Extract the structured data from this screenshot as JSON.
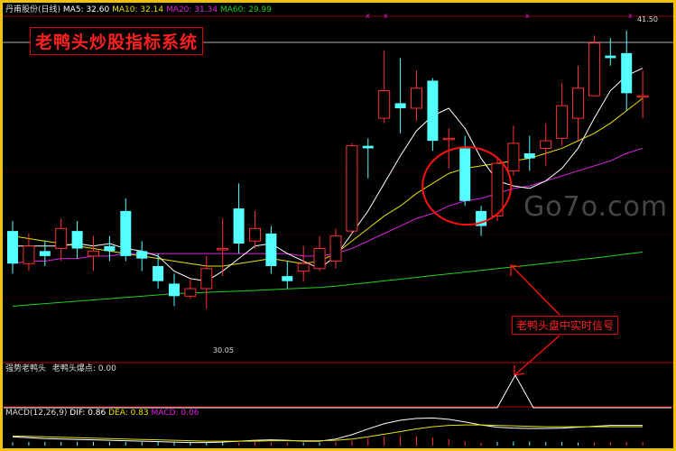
{
  "header": {
    "stock": "丹甫股份(日线)",
    "ma5": "MA5: 32.60",
    "ma10": "MA10: 32.14",
    "ma20": "MA20: 31.34",
    "ma60": "MA60: 29.99"
  },
  "title": "老鸭头炒股指标系统",
  "price_high": "41.50",
  "price_low": "30.05",
  "signal_label": "老鸭头盘中实时信号",
  "watermark": "Go7o.com",
  "indicator_header": {
    "name": "强势老鸭头",
    "buy": "老鸭头爆点: 0.00"
  },
  "macd_header": {
    "name": "MACD(12,26,9)",
    "dif": "DIF: 0.86",
    "dea": "DEA: 0.83",
    "macd": "MACD: 0.06"
  },
  "colors": {
    "up": "#ff3030",
    "down": "#54ffff",
    "ma5": "#ffffff",
    "ma10": "#e8e000",
    "ma20": "#e020e0",
    "ma60": "#20d020",
    "frame": "#f2c200"
  },
  "chart_data": {
    "type": "candlestick",
    "ylim": [
      28.5,
      42.0
    ],
    "candles": [
      {
        "o": 33.5,
        "c": 32.2,
        "h": 33.9,
        "l": 31.8
      },
      {
        "o": 32.2,
        "c": 32.9,
        "h": 33.4,
        "l": 31.9
      },
      {
        "o": 32.7,
        "c": 32.5,
        "h": 33.1,
        "l": 32.1
      },
      {
        "o": 32.8,
        "c": 33.6,
        "h": 34.0,
        "l": 32.3
      },
      {
        "o": 33.5,
        "c": 32.8,
        "h": 33.9,
        "l": 32.4
      },
      {
        "o": 32.5,
        "c": 32.7,
        "h": 33.3,
        "l": 31.9
      },
      {
        "o": 32.9,
        "c": 32.7,
        "h": 33.3,
        "l": 32.3
      },
      {
        "o": 34.3,
        "c": 32.5,
        "h": 34.8,
        "l": 32.3
      },
      {
        "o": 32.7,
        "c": 32.4,
        "h": 33.1,
        "l": 31.9
      },
      {
        "o": 32.1,
        "c": 31.5,
        "h": 32.6,
        "l": 31.2
      },
      {
        "o": 31.4,
        "c": 30.9,
        "h": 31.8,
        "l": 30.5
      },
      {
        "o": 30.9,
        "c": 31.2,
        "h": 31.6,
        "l": 30.8
      },
      {
        "o": 31.2,
        "c": 32.0,
        "h": 32.5,
        "l": 30.4
      },
      {
        "o": 32.8,
        "c": 32.8,
        "h": 34.0,
        "l": 31.7
      },
      {
        "o": 34.4,
        "c": 33.0,
        "h": 35.4,
        "l": 32.6
      },
      {
        "o": 33.1,
        "c": 33.6,
        "h": 34.3,
        "l": 32.8
      },
      {
        "o": 33.4,
        "c": 32.1,
        "h": 33.7,
        "l": 31.8
      },
      {
        "o": 31.7,
        "c": 31.5,
        "h": 32.3,
        "l": 31.2
      },
      {
        "o": 31.9,
        "c": 32.2,
        "h": 32.9,
        "l": 31.5
      },
      {
        "o": 32.0,
        "c": 32.8,
        "h": 33.3,
        "l": 31.9
      },
      {
        "o": 32.3,
        "c": 33.3,
        "h": 33.6,
        "l": 32.0
      },
      {
        "o": 33.5,
        "c": 36.9,
        "h": 37.0,
        "l": 33.4
      },
      {
        "o": 36.9,
        "c": 36.8,
        "h": 37.2,
        "l": 35.6
      },
      {
        "o": 38.0,
        "c": 39.1,
        "h": 40.7,
        "l": 37.8
      },
      {
        "o": 38.6,
        "c": 38.4,
        "h": 40.4,
        "l": 37.4
      },
      {
        "o": 38.4,
        "c": 39.2,
        "h": 39.9,
        "l": 37.9
      },
      {
        "o": 39.5,
        "c": 37.1,
        "h": 39.6,
        "l": 36.7
      },
      {
        "o": 37.2,
        "c": 37.2,
        "h": 37.6,
        "l": 36.0
      },
      {
        "o": 36.8,
        "c": 34.7,
        "h": 37.3,
        "l": 34.5
      },
      {
        "o": 34.3,
        "c": 33.7,
        "h": 34.5,
        "l": 33.3
      },
      {
        "o": 34.1,
        "c": 36.2,
        "h": 36.4,
        "l": 33.9
      },
      {
        "o": 35.9,
        "c": 37.0,
        "h": 37.7,
        "l": 35.7
      },
      {
        "o": 36.6,
        "c": 36.4,
        "h": 37.3,
        "l": 35.9
      },
      {
        "o": 36.8,
        "c": 37.1,
        "h": 37.8,
        "l": 36.1
      },
      {
        "o": 37.2,
        "c": 38.5,
        "h": 39.4,
        "l": 36.9
      },
      {
        "o": 38.0,
        "c": 39.2,
        "h": 40.1,
        "l": 37.1
      },
      {
        "o": 38.9,
        "c": 41.0,
        "h": 41.3,
        "l": 38.9
      },
      {
        "o": 40.5,
        "c": 40.4,
        "h": 41.2,
        "l": 40.1
      },
      {
        "o": 40.6,
        "c": 39.0,
        "h": 41.5,
        "l": 38.3
      },
      {
        "o": 38.9,
        "c": 38.9,
        "h": 39.9,
        "l": 38.0
      }
    ],
    "ma5": [
      32.9,
      32.9,
      32.9,
      32.9,
      33.0,
      32.9,
      33.0,
      32.8,
      32.7,
      32.5,
      31.9,
      31.6,
      31.5,
      31.9,
      32.4,
      32.9,
      33.0,
      32.6,
      32.3,
      32.0,
      32.5,
      33.4,
      34.3,
      35.4,
      36.5,
      37.5,
      38.1,
      38.4,
      37.6,
      36.4,
      35.5,
      35.3,
      35.2,
      35.5,
      36.0,
      36.8,
      38.0,
      39.1,
      39.7,
      40.0
    ],
    "ma10": [
      33.3,
      33.2,
      33.1,
      33.0,
      32.9,
      32.8,
      32.7,
      32.6,
      32.5,
      32.4,
      32.3,
      32.2,
      32.1,
      32.1,
      32.2,
      32.3,
      32.4,
      32.3,
      32.2,
      32.3,
      32.6,
      33.1,
      33.6,
      34.1,
      34.5,
      35.0,
      35.4,
      35.8,
      36.0,
      36.1,
      36.2,
      36.3,
      36.4,
      36.6,
      36.8,
      37.1,
      37.4,
      37.8,
      38.3,
      38.8
    ],
    "ma20": [
      32.2,
      32.3,
      32.3,
      32.4,
      32.4,
      32.5,
      32.5,
      32.6,
      32.6,
      32.6,
      32.6,
      32.6,
      32.6,
      32.6,
      32.6,
      32.6,
      32.6,
      32.6,
      32.5,
      32.5,
      32.6,
      32.8,
      33.1,
      33.4,
      33.7,
      34.0,
      34.2,
      34.5,
      34.7,
      34.8,
      35.0,
      35.2,
      35.3,
      35.5,
      35.7,
      35.9,
      36.1,
      36.3,
      36.6,
      36.8
    ],
    "ma60": [
      30.5,
      30.55,
      30.6,
      30.65,
      30.7,
      30.75,
      30.8,
      30.85,
      30.9,
      30.95,
      31.0,
      31.02,
      31.05,
      31.08,
      31.1,
      31.13,
      31.16,
      31.19,
      31.22,
      31.25,
      31.3,
      31.37,
      31.44,
      31.51,
      31.58,
      31.65,
      31.72,
      31.79,
      31.86,
      31.93,
      32.0,
      32.07,
      32.14,
      32.21,
      32.28,
      32.35,
      32.42,
      32.5,
      32.58,
      32.66
    ],
    "signal_index": 31,
    "macd": {
      "dif": [
        0.6,
        0.58,
        0.56,
        0.55,
        0.54,
        0.53,
        0.52,
        0.51,
        0.5,
        0.49,
        0.48,
        0.47,
        0.47,
        0.48,
        0.5,
        0.52,
        0.53,
        0.52,
        0.5,
        0.5,
        0.55,
        0.65,
        0.78,
        0.9,
        0.98,
        1.02,
        1.03,
        1.0,
        0.94,
        0.87,
        0.82,
        0.8,
        0.79,
        0.79,
        0.8,
        0.82,
        0.84,
        0.86,
        0.86,
        0.86
      ],
      "dea": [
        0.62,
        0.61,
        0.6,
        0.59,
        0.58,
        0.57,
        0.56,
        0.55,
        0.54,
        0.53,
        0.52,
        0.51,
        0.5,
        0.5,
        0.5,
        0.5,
        0.51,
        0.51,
        0.51,
        0.51,
        0.52,
        0.55,
        0.6,
        0.66,
        0.72,
        0.78,
        0.83,
        0.86,
        0.87,
        0.87,
        0.86,
        0.85,
        0.84,
        0.83,
        0.83,
        0.83,
        0.83,
        0.83,
        0.83,
        0.83
      ]
    }
  }
}
